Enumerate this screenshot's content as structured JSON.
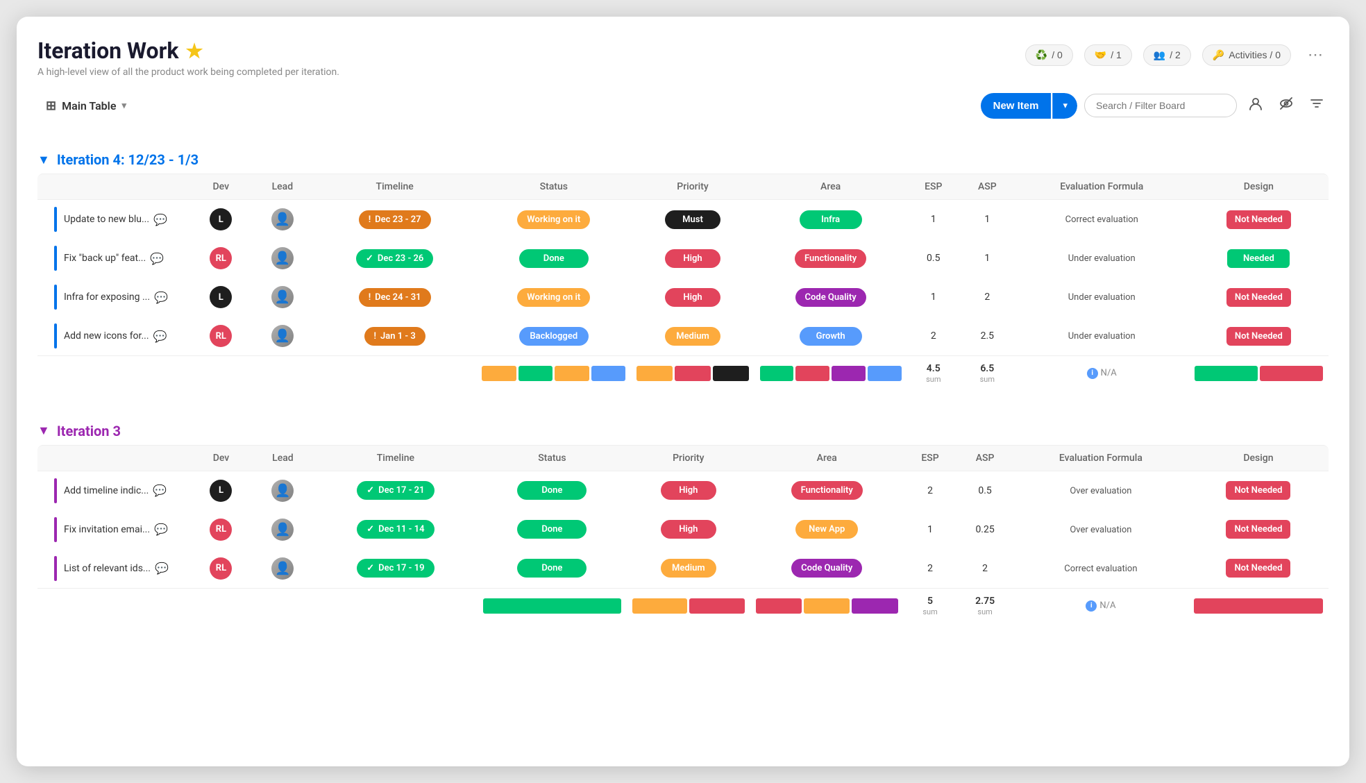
{
  "page": {
    "title": "Iteration Work",
    "subtitle": "A high-level view of all the product work being completed per iteration."
  },
  "header_stats": [
    {
      "icon": "🔄",
      "value": "/ 0"
    },
    {
      "icon": "🤝",
      "value": "/ 1"
    },
    {
      "icon": "👥",
      "value": "/ 2"
    }
  ],
  "activities_label": "Activities / 0",
  "toolbar": {
    "table_name": "Main Table",
    "new_item_label": "New Item",
    "search_placeholder": "Search / Filter Board"
  },
  "groups": [
    {
      "id": "iteration4",
      "title": "Iteration 4: 12/23 - 1/3",
      "color": "blue",
      "color_hex": "#0073ea",
      "columns": [
        "Dev",
        "Lead",
        "Timeline",
        "Status",
        "Priority",
        "Area",
        "ESP",
        "ASP",
        "Evaluation Formula",
        "Design"
      ],
      "rows": [
        {
          "name": "Update to new blu...",
          "border_color": "#0073ea",
          "dev_initials": "L",
          "dev_color": "#1e1e1e",
          "timeline": "Dec 23 - 27",
          "timeline_type": "orange",
          "timeline_icon": "!",
          "status": "Working on it",
          "status_class": "status-working",
          "priority": "Must",
          "priority_class": "priority-must",
          "area": "Infra",
          "area_class": "area-infra",
          "esp": "1",
          "asp": "1",
          "evaluation": "Correct evaluation",
          "design": "Not Needed",
          "design_class": "design-not-needed"
        },
        {
          "name": "Fix \"back up\" feat...",
          "border_color": "#0073ea",
          "dev_initials": "RL",
          "dev_color": "#e2445c",
          "timeline": "Dec 23 - 26",
          "timeline_type": "green",
          "timeline_icon": "✓",
          "status": "Done",
          "status_class": "status-done",
          "priority": "High",
          "priority_class": "priority-high",
          "area": "Functionality",
          "area_class": "area-functionality",
          "esp": "0.5",
          "asp": "1",
          "evaluation": "Under evaluation",
          "design": "Needed",
          "design_class": "design-needed"
        },
        {
          "name": "Infra for exposing ...",
          "border_color": "#0073ea",
          "dev_initials": "L",
          "dev_color": "#1e1e1e",
          "timeline": "Dec 24 - 31",
          "timeline_type": "orange",
          "timeline_icon": "!",
          "status": "Working on it",
          "status_class": "status-working",
          "priority": "High",
          "priority_class": "priority-high",
          "area": "Code Quality",
          "area_class": "area-code-quality",
          "esp": "1",
          "asp": "2",
          "evaluation": "Under evaluation",
          "design": "Not Needed",
          "design_class": "design-not-needed"
        },
        {
          "name": "Add new icons for...",
          "border_color": "#0073ea",
          "dev_initials": "RL",
          "dev_color": "#e2445c",
          "timeline": "Jan 1 - 3",
          "timeline_type": "orange",
          "timeline_icon": "!",
          "status": "Backlogged",
          "status_class": "status-backlogged",
          "priority": "Medium",
          "priority_class": "priority-medium",
          "area": "Growth",
          "area_class": "area-growth",
          "esp": "2",
          "asp": "2.5",
          "evaluation": "Under evaluation",
          "design": "Not Needed",
          "design_class": "design-not-needed"
        }
      ],
      "summary": {
        "esp_sum": "4.5",
        "asp_sum": "6.5",
        "status_colors": [
          "#fdab3d",
          "#00c875",
          "#fdab3d",
          "#579bfc"
        ],
        "priority_colors": [
          "#fdab3d",
          "#e2445c",
          "#1e1e1e"
        ],
        "area_colors": [
          "#00c875",
          "#e2445c",
          "#9c27b0",
          "#579bfc"
        ],
        "design_colors": [
          "#00c875",
          "#e2445c"
        ]
      }
    },
    {
      "id": "iteration3",
      "title": "Iteration 3",
      "color": "purple",
      "color_hex": "#9c27b0",
      "columns": [
        "Dev",
        "Lead",
        "Timeline",
        "Status",
        "Priority",
        "Area",
        "ESP",
        "ASP",
        "Evaluation Formula",
        "Design"
      ],
      "rows": [
        {
          "name": "Add timeline indic...",
          "border_color": "#9c27b0",
          "dev_initials": "L",
          "dev_color": "#1e1e1e",
          "timeline": "Dec 17 - 21",
          "timeline_type": "green",
          "timeline_icon": "✓",
          "status": "Done",
          "status_class": "status-done",
          "priority": "High",
          "priority_class": "priority-high",
          "area": "Functionality",
          "area_class": "area-functionality",
          "esp": "2",
          "asp": "0.5",
          "evaluation": "Over evaluation",
          "design": "Not Needed",
          "design_class": "design-not-needed"
        },
        {
          "name": "Fix invitation emai...",
          "border_color": "#9c27b0",
          "dev_initials": "RL",
          "dev_color": "#e2445c",
          "timeline": "Dec 11 - 14",
          "timeline_type": "green",
          "timeline_icon": "✓",
          "status": "Done",
          "status_class": "status-done",
          "priority": "High",
          "priority_class": "priority-high",
          "area": "New App",
          "area_class": "area-new-app",
          "esp": "1",
          "asp": "0.25",
          "evaluation": "Over evaluation",
          "design": "Not Needed",
          "design_class": "design-not-needed"
        },
        {
          "name": "List of relevant ids...",
          "border_color": "#9c27b0",
          "dev_initials": "RL",
          "dev_color": "#e2445c",
          "timeline": "Dec 17 - 19",
          "timeline_type": "green",
          "timeline_icon": "✓",
          "status": "Done",
          "status_class": "status-done",
          "priority": "Medium",
          "priority_class": "priority-medium",
          "area": "Code Quality",
          "area_class": "area-code-quality",
          "esp": "2",
          "asp": "2",
          "evaluation": "Correct evaluation",
          "design": "Not Needed",
          "design_class": "design-not-needed"
        }
      ],
      "summary": {
        "esp_sum": "5",
        "asp_sum": "2.75",
        "status_colors": [
          "#00c875"
        ],
        "priority_colors": [
          "#fdab3d",
          "#e2445c"
        ],
        "area_colors": [
          "#e2445c",
          "#fdab3d",
          "#9c27b0"
        ],
        "design_colors": [
          "#e2445c"
        ]
      }
    }
  ]
}
